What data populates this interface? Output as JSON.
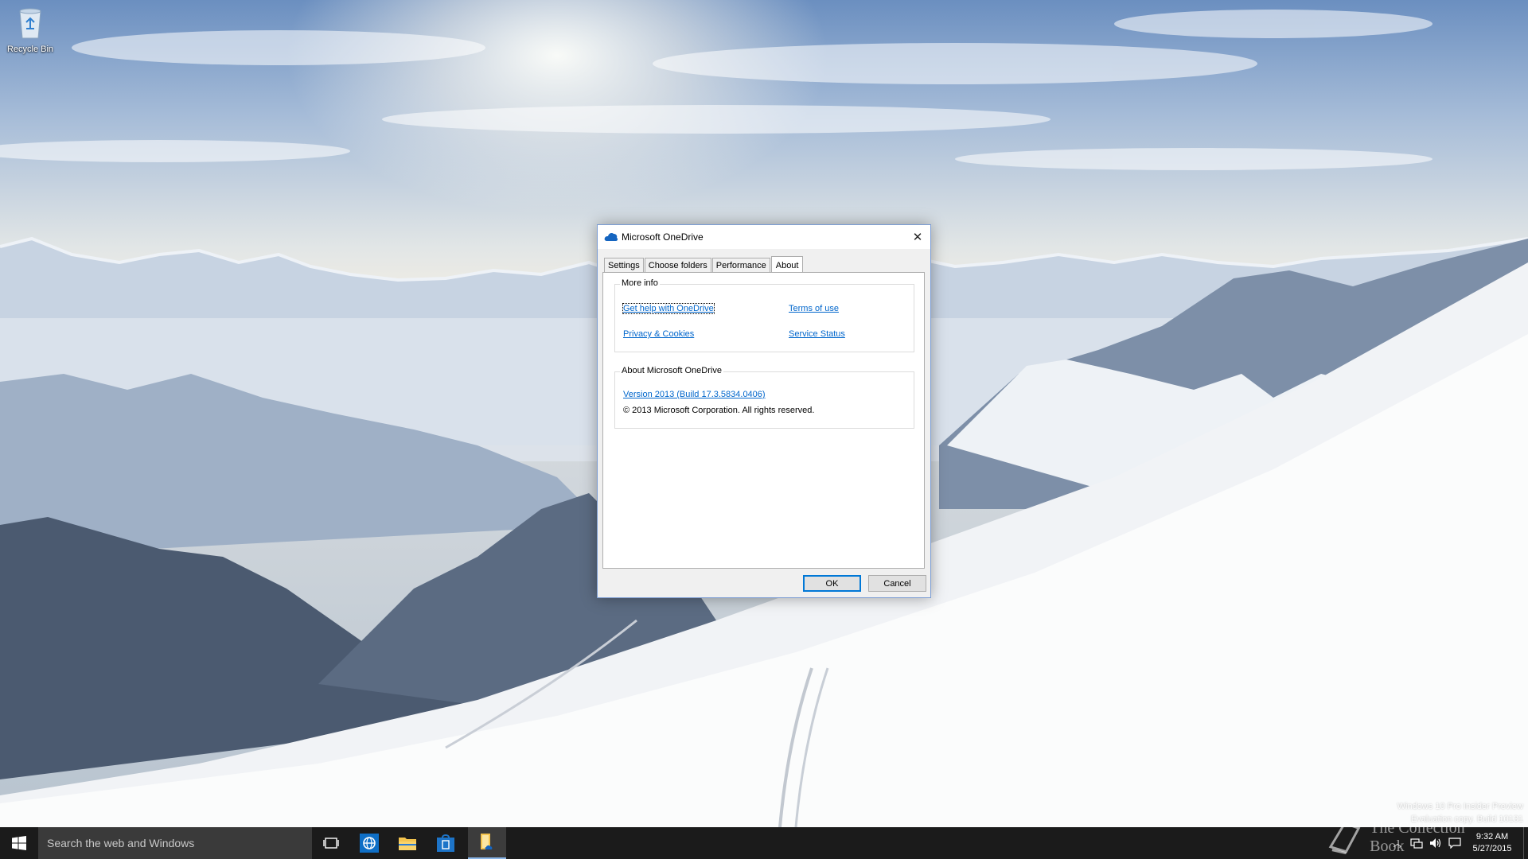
{
  "desktop": {
    "icons": [
      {
        "label": "Recycle Bin",
        "icon": "recycle-bin-icon"
      }
    ],
    "watermark": {
      "line1": "Windows 10 Pro Insider Preview",
      "line2": "Evaluation copy. Build 10131"
    },
    "brand": "The Collection Book"
  },
  "dialog": {
    "title": "Microsoft OneDrive",
    "close_label": "✕",
    "tabs": [
      {
        "label": "Settings",
        "active": false
      },
      {
        "label": "Choose folders",
        "active": false
      },
      {
        "label": "Performance",
        "active": false
      },
      {
        "label": "About",
        "active": true
      }
    ],
    "more_info": {
      "legend": "More info",
      "links": {
        "help": "Get help with OneDrive",
        "terms": "Terms of use",
        "privacy": "Privacy & Cookies",
        "status": "Service Status"
      }
    },
    "about": {
      "legend": "About Microsoft OneDrive",
      "version": "Version 2013 (Build 17.3.5834.0406)",
      "copyright": "© 2013 Microsoft Corporation. All rights reserved."
    },
    "buttons": {
      "ok": "OK",
      "cancel": "Cancel"
    }
  },
  "taskbar": {
    "search_placeholder": "Search the web and Windows",
    "apps": [
      "task-view-icon",
      "internet-explorer-icon",
      "file-explorer-icon",
      "store-icon",
      "onedrive-setup-icon"
    ],
    "clock": {
      "time": "9:32 AM",
      "date": "5/27/2015"
    }
  },
  "colors": {
    "accent": "#0078d7",
    "link": "#0066cc",
    "taskbar": "#1b1b1b"
  }
}
